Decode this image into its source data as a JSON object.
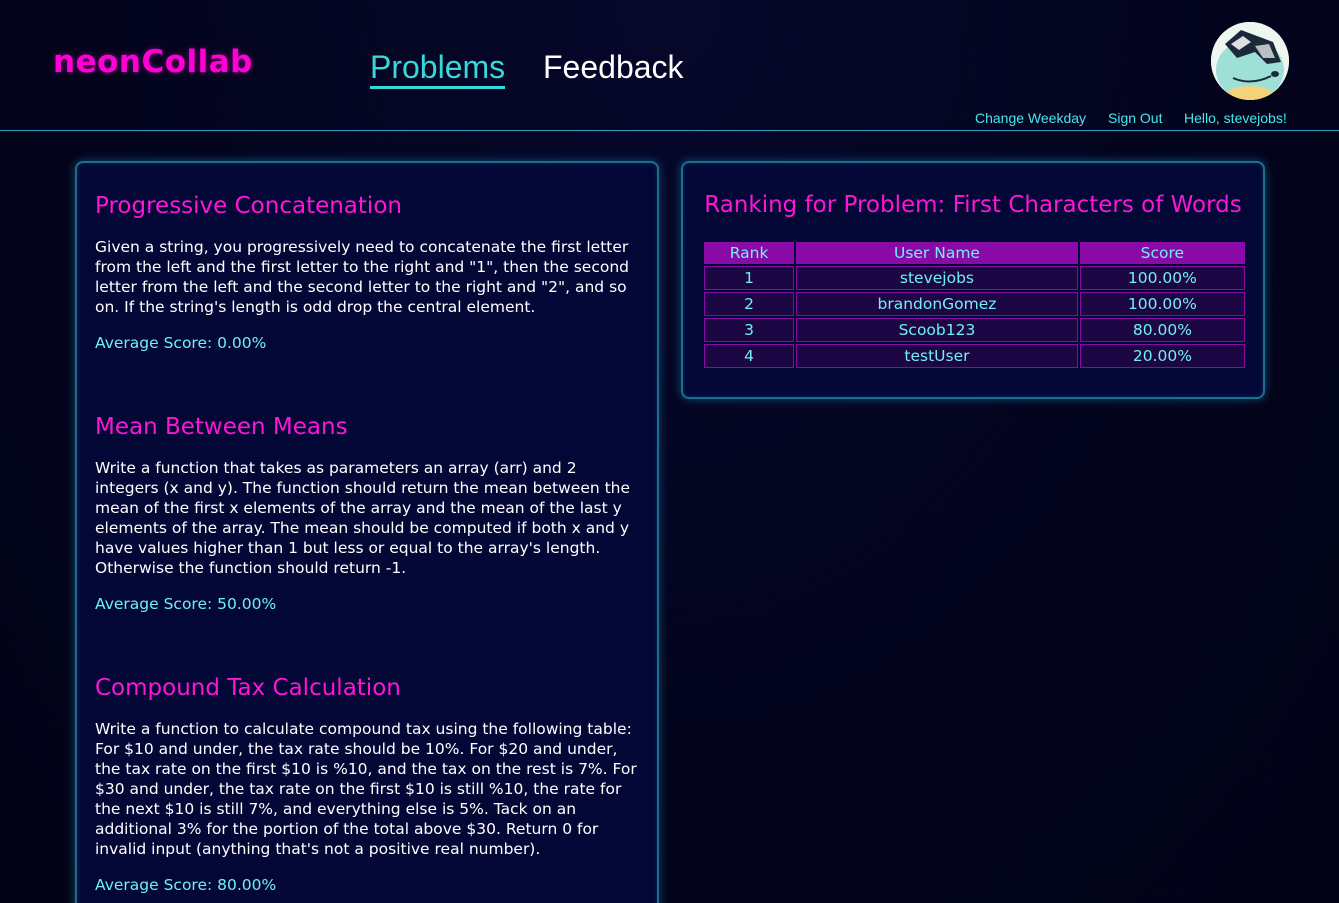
{
  "header": {
    "logo": "neonCollab",
    "nav": {
      "problems": "Problems",
      "feedback": "Feedback"
    },
    "user_links": {
      "change_weekday": "Change Weekday",
      "sign_out": "Sign Out",
      "greeting": "Hello, stevejobs!"
    },
    "avatar_icon": "cartoon-turtle-sunglasses-avatar"
  },
  "problems": [
    {
      "title": "Progressive Concatenation",
      "description": "Given a string, you progressively need to concatenate the first letter from the left and the first letter to the right and \"1\", then the second letter from the left and the second letter to the right and \"2\", and so on. If the string's length is odd drop the central element.",
      "average": "Average Score: 0.00%"
    },
    {
      "title": "Mean Between Means",
      "description": "Write a function that takes as parameters an array (arr) and 2 integers (x and y). The function should return the mean between the mean of the first x elements of the array and the mean of the last y elements of the array. The mean should be computed if both x and y have values higher than 1 but less or equal to the array's length. Otherwise the function should return -1.",
      "average": "Average Score: 50.00%"
    },
    {
      "title": "Compound Tax Calculation",
      "description": "Write a function to calculate compound tax using the following table: For $10 and under, the tax rate should be 10%. For $20 and under, the tax rate on the first $10 is %10, and the tax on the rest is 7%. For $30 and under, the tax rate on the first $10 is still %10, the rate for the next $10 is still 7%, and everything else is 5%. Tack on an additional 3% for the portion of the total above $30. Return 0 for invalid input (anything that's not a positive real number).",
      "average": "Average Score: 80.00%"
    }
  ],
  "ranking": {
    "title": "Ranking for Problem: First Characters of Words",
    "columns": [
      "Rank",
      "User Name",
      "Score"
    ],
    "rows": [
      [
        "1",
        "stevejobs",
        "100.00%"
      ],
      [
        "2",
        "brandonGomez",
        "100.00%"
      ],
      [
        "3",
        "Scoob123",
        "80.00%"
      ],
      [
        "4",
        "testUser",
        "20.00%"
      ]
    ]
  },
  "colors": {
    "background": "#03041c",
    "logo": "#ff00d4",
    "accent_cyan": "#35d9d9",
    "heading_magenta": "#ff14d8",
    "table_header": "#8a0aa8"
  }
}
